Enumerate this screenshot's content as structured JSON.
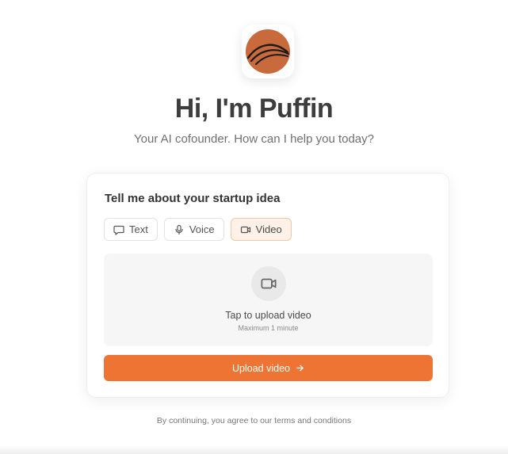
{
  "brand": {
    "logo_icon": "puffin-logo-icon",
    "logo_color": "#c96a3c"
  },
  "hero": {
    "title": "Hi, I'm Puffin",
    "subtitle": "Your AI cofounder. How can I help you today?"
  },
  "card": {
    "title": "Tell me about your startup idea",
    "modes": [
      {
        "label": "Text",
        "icon": "message-icon",
        "active": false
      },
      {
        "label": "Voice",
        "icon": "microphone-icon",
        "active": false
      },
      {
        "label": "Video",
        "icon": "video-camera-icon",
        "active": true
      }
    ],
    "upload": {
      "icon": "video-camera-icon",
      "label": "Tap to upload video",
      "hint": "Maximum 1 minute"
    },
    "submit": {
      "label": "Upload video",
      "icon": "arrow-right-icon"
    }
  },
  "footer": {
    "text": "By continuing, you agree to our terms and conditions"
  },
  "colors": {
    "accent": "#ee7433",
    "active_tab_bg": "#fdf1e8",
    "active_tab_border": "#f0c7a8"
  }
}
